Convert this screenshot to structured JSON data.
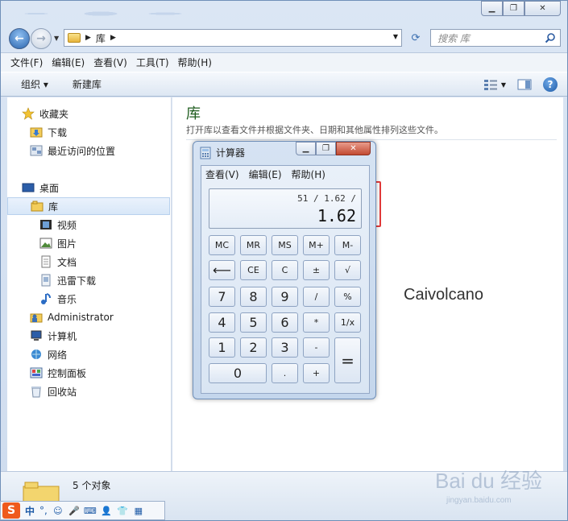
{
  "explorer": {
    "address": {
      "crumb": "库",
      "search_placeholder": "搜索 库"
    },
    "menu": [
      "文件(F)",
      "编辑(E)",
      "查看(V)",
      "工具(T)",
      "帮助(H)"
    ],
    "toolbar": {
      "organize": "组织 ▾",
      "new_library": "新建库"
    },
    "nav": {
      "favorites": "收藏夹",
      "downloads": "下载",
      "recent": "最近访问的位置",
      "desktop": "桌面",
      "libraries": "库",
      "videos": "视频",
      "pictures": "图片",
      "documents": "文档",
      "xunlei": "迅雷下载",
      "music": "音乐",
      "admin": "Administrator",
      "computer": "计算机",
      "network": "网络",
      "control_panel": "控制面板",
      "recycle": "回收站"
    },
    "content": {
      "title": "库",
      "subtitle": "打开库以查看文件并根据文件夹、日期和其他属性排列这些文件。",
      "overlay_text": "Caivolcano"
    },
    "status": {
      "count": "5 个对象"
    }
  },
  "calculator": {
    "title": "计算器",
    "menu": [
      "查看(V)",
      "编辑(E)",
      "帮助(H)"
    ],
    "expression": "51 / 1.62 /",
    "value": "1.62",
    "keys": {
      "mc": "MC",
      "mr": "MR",
      "ms": "MS",
      "mplus": "M+",
      "mminus": "M-",
      "back": "⟵",
      "ce": "CE",
      "c": "C",
      "pm": "±",
      "sqrt": "√",
      "k7": "7",
      "k8": "8",
      "k9": "9",
      "div": "/",
      "pct": "%",
      "k4": "4",
      "k5": "5",
      "k6": "6",
      "mul": "*",
      "inv": "1/x",
      "k1": "1",
      "k2": "2",
      "k3": "3",
      "sub": "-",
      "eq": "=",
      "k0": "0",
      "dot": ".",
      "add": "+"
    }
  },
  "ime": {
    "lang": "中",
    "punct": "°,"
  },
  "watermark": {
    "brand": "Bai du 经验",
    "url": "jingyan.baidu.com"
  },
  "colors": {
    "accent_green": "#1e5c1e",
    "highlight": "#e23a3a",
    "ime_orange": "#ef5a1c"
  }
}
